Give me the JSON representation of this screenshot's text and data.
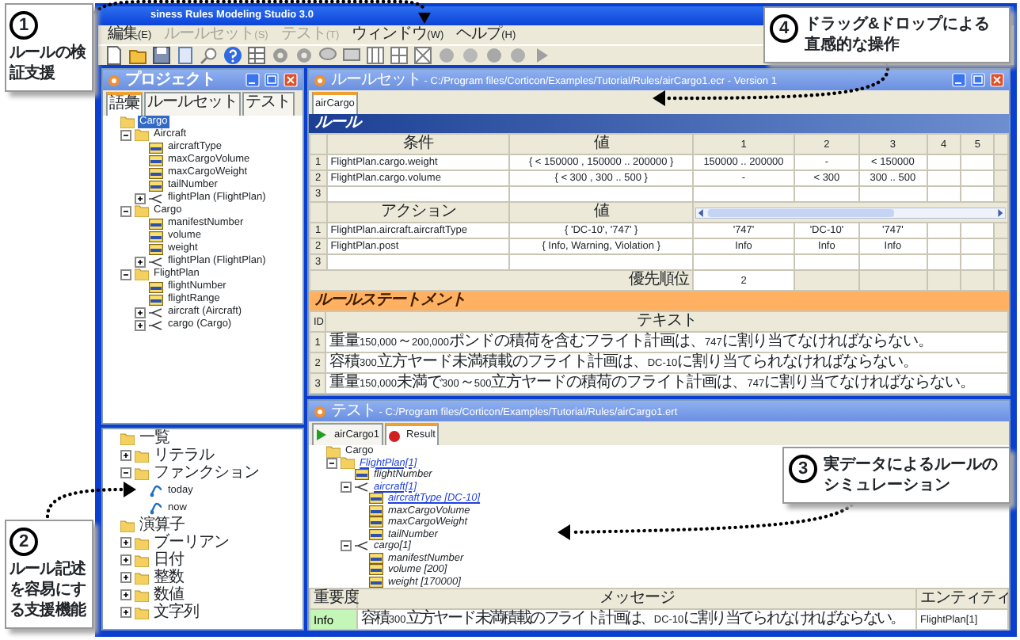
{
  "callouts": [
    {
      "number": "1",
      "text": "ルールの検証支援"
    },
    {
      "number": "4",
      "text": "ドラッグ&ドロップによる直感的な操作"
    },
    {
      "number": "3",
      "text": "実データによるルールのシミュレーション"
    },
    {
      "number": "2",
      "text": "ルール記述を容易にする支援機能"
    }
  ],
  "window": {
    "title": "siness Rules Modeling Studio 3.0"
  },
  "menu": [
    {
      "label": "編集(E)",
      "disabled": false
    },
    {
      "label": "ルールセット(S)",
      "disabled": true
    },
    {
      "label": "テスト(T)",
      "disabled": true
    },
    {
      "label": "ウィンドウ(W)",
      "disabled": false
    },
    {
      "label": "ヘルプ(H)",
      "disabled": false
    }
  ],
  "project_panel": {
    "title": "プロジェクト",
    "tabs": [
      {
        "label": "語彙",
        "selected": true
      },
      {
        "label": "ルールセット",
        "selected": false
      },
      {
        "label": "テスト",
        "selected": false
      }
    ],
    "tree": [
      {
        "label": "Cargo",
        "kind": "folder",
        "selected": true,
        "children": [
          {
            "label": "Aircraft",
            "kind": "folder",
            "selected": false,
            "expanded": true,
            "children": [
              {
                "label": "aircraftType",
                "kind": "attribute",
                "selected": false
              },
              {
                "label": "maxCargoVolume",
                "kind": "attribute",
                "selected": false
              },
              {
                "label": "maxCargoWeight",
                "kind": "attribute",
                "selected": false
              },
              {
                "label": "tailNumber",
                "kind": "attribute",
                "selected": false
              },
              {
                "label": "flightPlan (FlightPlan)",
                "kind": "association",
                "selected": false,
                "expanded": false
              }
            ]
          },
          {
            "label": "Cargo",
            "kind": "folder",
            "selected": false,
            "expanded": true,
            "children": [
              {
                "label": "manifestNumber",
                "kind": "attribute",
                "selected": false
              },
              {
                "label": "volume",
                "kind": "attribute",
                "selected": false
              },
              {
                "label": "weight",
                "kind": "attribute",
                "selected": false
              },
              {
                "label": "flightPlan (FlightPlan)",
                "kind": "association",
                "selected": false,
                "expanded": false
              }
            ]
          },
          {
            "label": "FlightPlan",
            "kind": "folder",
            "selected": false,
            "expanded": true,
            "children": [
              {
                "label": "flightNumber",
                "kind": "attribute",
                "selected": false
              },
              {
                "label": "flightRange",
                "kind": "attribute",
                "selected": false
              },
              {
                "label": "aircraft (Aircraft)",
                "kind": "association",
                "selected": false,
                "expanded": false
              },
              {
                "label": "cargo (Cargo)",
                "kind": "association",
                "selected": false,
                "expanded": false
              }
            ]
          }
        ]
      }
    ]
  },
  "palette_panel": {
    "tree": [
      {
        "label": "一覧",
        "kind": "folder",
        "children": [
          {
            "label": "リテラル",
            "kind": "folder",
            "expanded": false
          },
          {
            "label": "ファンクション",
            "kind": "folder",
            "expanded": true,
            "children": [
              {
                "label": "today",
                "kind": "function"
              },
              {
                "label": "now",
                "kind": "function"
              }
            ]
          }
        ]
      },
      {
        "label": "演算子",
        "kind": "folder",
        "children": [
          {
            "label": "ブーリアン",
            "kind": "folder",
            "expanded": false
          },
          {
            "label": "日付",
            "kind": "folder",
            "expanded": false
          },
          {
            "label": "整数",
            "kind": "folder",
            "expanded": false
          },
          {
            "label": "数値",
            "kind": "folder",
            "expanded": false
          },
          {
            "label": "文字列",
            "kind": "folder",
            "expanded": false
          }
        ]
      }
    ]
  },
  "ruleset_window": {
    "title": "ルールセット - C:/Program files/Corticon/Examples/Tutorial/Rules/airCargo1.ecr - Version 1",
    "tab": "airCargo",
    "section": "ルール",
    "conditions": {
      "columns": [
        "条件",
        "値",
        "1",
        "2",
        "3",
        "4",
        "5"
      ],
      "rows": [
        {
          "number": "1",
          "cells": [
            "FlightPlan.cargo.weight",
            "{ < 150000 , 150000 .. 200000 }",
            "150000 .. 200000",
            "-",
            "< 150000"
          ]
        },
        {
          "number": "2",
          "cells": [
            "FlightPlan.cargo.volume",
            "{ < 300 , 300 .. 500 }",
            "-",
            "< 300",
            "300 .. 500"
          ]
        },
        {
          "number": "3",
          "cells": []
        }
      ]
    },
    "actions": {
      "columns": [
        "アクション",
        "値"
      ],
      "rows": [
        {
          "number": "1",
          "cells": [
            "FlightPlan.aircraft.aircraftType",
            "{ 'DC-10', '747' }",
            "'747'",
            "'DC-10'",
            "'747'"
          ]
        },
        {
          "number": "2",
          "cells": [
            "FlightPlan.post",
            "{ Info, Warning, Violation }",
            "Info",
            "Info",
            "Info"
          ]
        },
        {
          "number": "3",
          "cells": []
        }
      ]
    },
    "priority": {
      "label": "優先順位",
      "value": "2"
    },
    "statements": {
      "title": "ルールステートメント",
      "columns": [
        "ID",
        "テキスト"
      ],
      "rows": [
        {
          "id": "1",
          "text": "重量150,000～200,000ポンドの積荷を含むフライト計画は、747に割り当てなければならない。"
        },
        {
          "id": "2",
          "text": "容積300立方ヤード未満積載のフライト計画は、DC-10に割り当てられなければならない。"
        },
        {
          "id": "3",
          "text": "重量150,000未満で300～500立方ヤードの積荷のフライト計画は、747に割り当てなければならない。"
        }
      ]
    }
  },
  "test_window": {
    "title": "テスト - C:/Program files/Corticon/Examples/Tutorial/Rules/airCargo1.ert",
    "tabs": [
      {
        "label": "airCargo1",
        "kind": "input",
        "selected": false
      },
      {
        "label": "Result",
        "kind": "result",
        "selected": true
      }
    ],
    "tree": [
      {
        "label": "Cargo",
        "kind": "folder",
        "highlighted": false,
        "children": [
          {
            "label": "FlightPlan[1]",
            "kind": "folder",
            "highlighted": true,
            "expanded": true,
            "children": [
              {
                "label": "flightNumber",
                "kind": "attribute",
                "highlighted": false
              },
              {
                "label": "aircraft[1]",
                "kind": "association",
                "highlighted": true,
                "expanded": true,
                "children": [
                  {
                    "label": "aircraftType [DC-10]",
                    "kind": "attribute",
                    "highlighted": true
                  },
                  {
                    "label": "maxCargoVolume",
                    "kind": "attribute",
                    "highlighted": false
                  },
                  {
                    "label": "maxCargoWeight",
                    "kind": "attribute",
                    "highlighted": false
                  },
                  {
                    "label": "tailNumber",
                    "kind": "attribute",
                    "highlighted": false
                  }
                ]
              },
              {
                "label": "cargo[1]",
                "kind": "association",
                "highlighted": false,
                "expanded": true,
                "children": [
                  {
                    "label": "manifestNumber",
                    "kind": "attribute",
                    "highlighted": false
                  },
                  {
                    "label": "volume [200]",
                    "kind": "attribute",
                    "highlighted": false
                  },
                  {
                    "label": "weight [170000]",
                    "kind": "attribute",
                    "highlighted": false
                  }
                ]
              }
            ]
          }
        ]
      }
    ],
    "messages": {
      "columns": [
        "重要度",
        "メッセージ",
        "エンティティ"
      ],
      "rows": [
        {
          "kind": "info",
          "severity": "Info",
          "message": "容積300立方ヤード未満積載のフライト計画は、DC-10に割り当てられなければならない。",
          "entity": "FlightPlan[1]"
        }
      ]
    }
  }
}
